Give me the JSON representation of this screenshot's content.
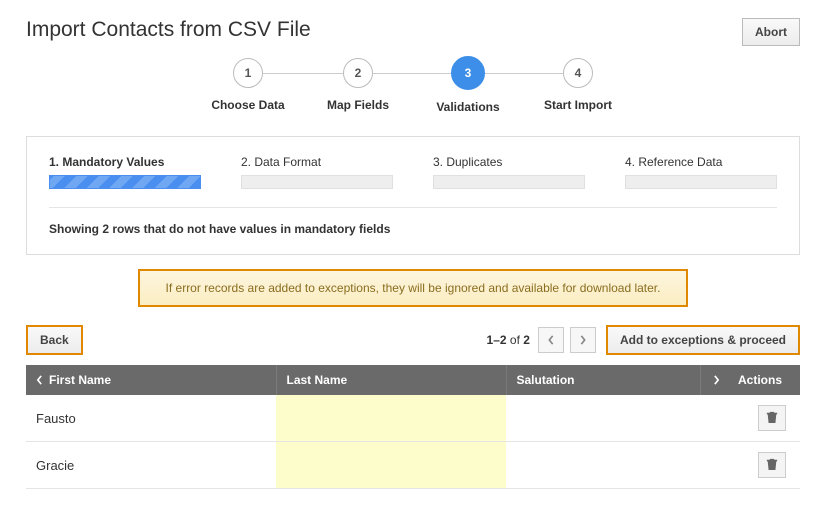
{
  "header": {
    "title": "Import Contacts from CSV File",
    "abort": "Abort"
  },
  "wizard": [
    {
      "num": "1",
      "label": "Choose Data",
      "active": false
    },
    {
      "num": "2",
      "label": "Map Fields",
      "active": false
    },
    {
      "num": "3",
      "label": "Validations",
      "active": true
    },
    {
      "num": "4",
      "label": "Start Import",
      "active": false
    }
  ],
  "subtabs": [
    {
      "label": "1. Mandatory Values",
      "active": true
    },
    {
      "label": "2. Data Format",
      "active": false
    },
    {
      "label": "3. Duplicates",
      "active": false
    },
    {
      "label": "4. Reference Data",
      "active": false
    }
  ],
  "status_text": "Showing 2 rows that do not have values in mandatory fields",
  "notice": "If error records are added to exceptions, they will be ignored and available for download later.",
  "actions": {
    "back": "Back",
    "proceed": "Add to exceptions & proceed"
  },
  "pager": {
    "range": "1–2",
    "of_word": "of",
    "total": "2"
  },
  "table": {
    "columns": [
      "First Name",
      "Last Name",
      "Salutation"
    ],
    "actions_label": "Actions",
    "rows": [
      {
        "first": "Fausto",
        "last": "",
        "sal": ""
      },
      {
        "first": "Gracie",
        "last": "",
        "sal": ""
      }
    ],
    "highlight_col": 1
  }
}
